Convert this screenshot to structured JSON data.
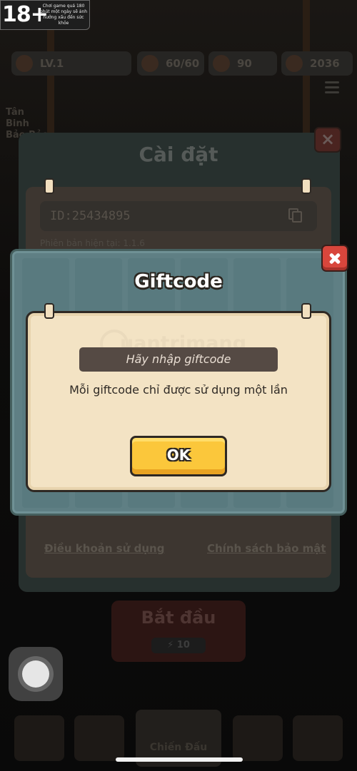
{
  "age_badge": {
    "rating": "18+",
    "warning": "Chơi game quá 180 phút một ngày sẽ ảnh hưởng xấu đến sức khỏe"
  },
  "background": {
    "player_level": "LV.1",
    "currency_1": "60/60",
    "currency_2": "90",
    "currency_3": "2036",
    "hero_name": "Tân Binh Bảo Bảo",
    "start_button": "Bắt đầu",
    "start_cost": "10",
    "bottom_nav_center": "Chiến Đấu"
  },
  "settings": {
    "title": "Cài đặt",
    "player_id": "ID:25434895",
    "version": "Phiên bản hiện tại: 1.1.6",
    "terms_link": "Điều khoản sử dụng",
    "privacy_link": "Chính sách bảo mật"
  },
  "giftcode": {
    "title": "Giftcode",
    "input_placeholder": "Hãy nhập giftcode",
    "note": "Mỗi giftcode chỉ được sử dụng một lần",
    "ok_label": "OK"
  },
  "watermark": "uantrimang",
  "icons": [
    "close-icon",
    "copy-icon",
    "coin-icon",
    "menu-icon",
    "assistive-touch-icon"
  ]
}
